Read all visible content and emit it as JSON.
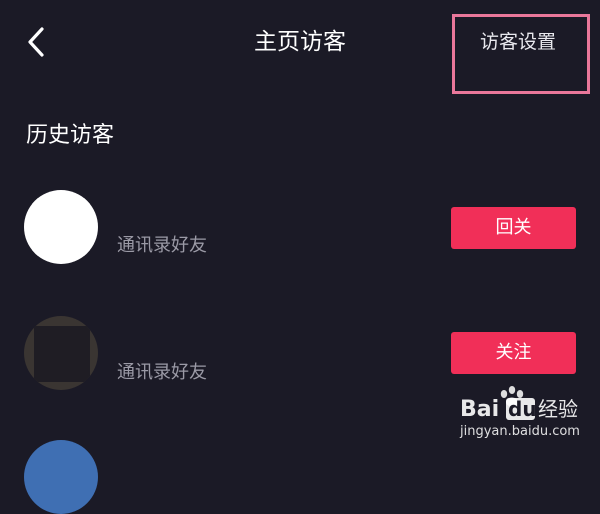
{
  "header": {
    "title": "主页访客",
    "settings_label": "访客设置"
  },
  "section": {
    "title": "历史访客"
  },
  "visitors": [
    {
      "subtitle": "通讯录好友",
      "button_label": "回关"
    },
    {
      "subtitle": "通讯录好友",
      "button_label": "关注"
    }
  ],
  "watermark": {
    "brand_left": "Bai",
    "brand_right": "du",
    "brand_cn": "经验",
    "url": "jingyan.baidu.com"
  },
  "colors": {
    "background": "#1b1a26",
    "accent_button": "#f12f58",
    "highlight_box": "#e9779a",
    "subtitle_text": "#9b9aa6"
  },
  "icons": {
    "back": "chevron-left-icon"
  }
}
